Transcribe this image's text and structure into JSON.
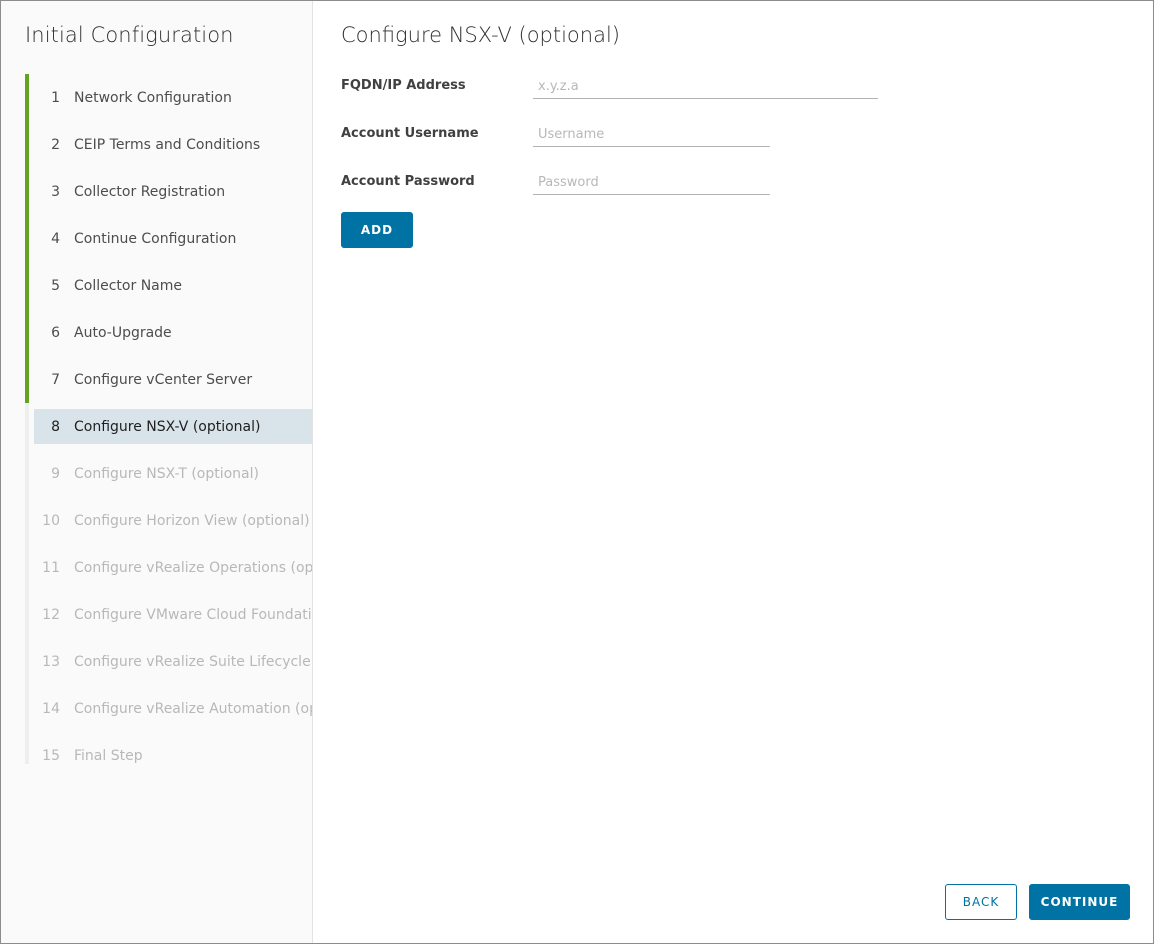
{
  "sidebar": {
    "title": "Initial Configuration",
    "steps": [
      {
        "num": "1",
        "label": "Network Configuration"
      },
      {
        "num": "2",
        "label": "CEIP Terms and Conditions"
      },
      {
        "num": "3",
        "label": "Collector Registration"
      },
      {
        "num": "4",
        "label": "Continue Configuration"
      },
      {
        "num": "5",
        "label": "Collector Name"
      },
      {
        "num": "6",
        "label": "Auto-Upgrade"
      },
      {
        "num": "7",
        "label": "Configure vCenter Server"
      },
      {
        "num": "8",
        "label": "Configure NSX-V (optional)"
      },
      {
        "num": "9",
        "label": "Configure NSX-T (optional)"
      },
      {
        "num": "10",
        "label": "Configure Horizon View (optional)"
      },
      {
        "num": "11",
        "label": "Configure vRealize Operations (optional)"
      },
      {
        "num": "12",
        "label": "Configure VMware Cloud Foundation (optional)"
      },
      {
        "num": "13",
        "label": "Configure vRealize Suite Lifecycle Manager (optional)"
      },
      {
        "num": "14",
        "label": "Configure vRealize Automation (optional)"
      },
      {
        "num": "15",
        "label": "Final Step"
      }
    ]
  },
  "main": {
    "title": "Configure NSX-V (optional)",
    "fqdn": {
      "label": "FQDN/IP Address",
      "value": "",
      "placeholder": "x.y.z.a"
    },
    "username": {
      "label": "Account Username",
      "value": "",
      "placeholder": "Username"
    },
    "password": {
      "label": "Account Password",
      "value": "",
      "placeholder": "Password"
    },
    "add_label": "ADD"
  },
  "footer": {
    "back_label": "BACK",
    "continue_label": "CONTINUE"
  },
  "colors": {
    "accent": "#0072a3",
    "done_bar": "#62a420",
    "active_bg": "#d9e4ea"
  }
}
